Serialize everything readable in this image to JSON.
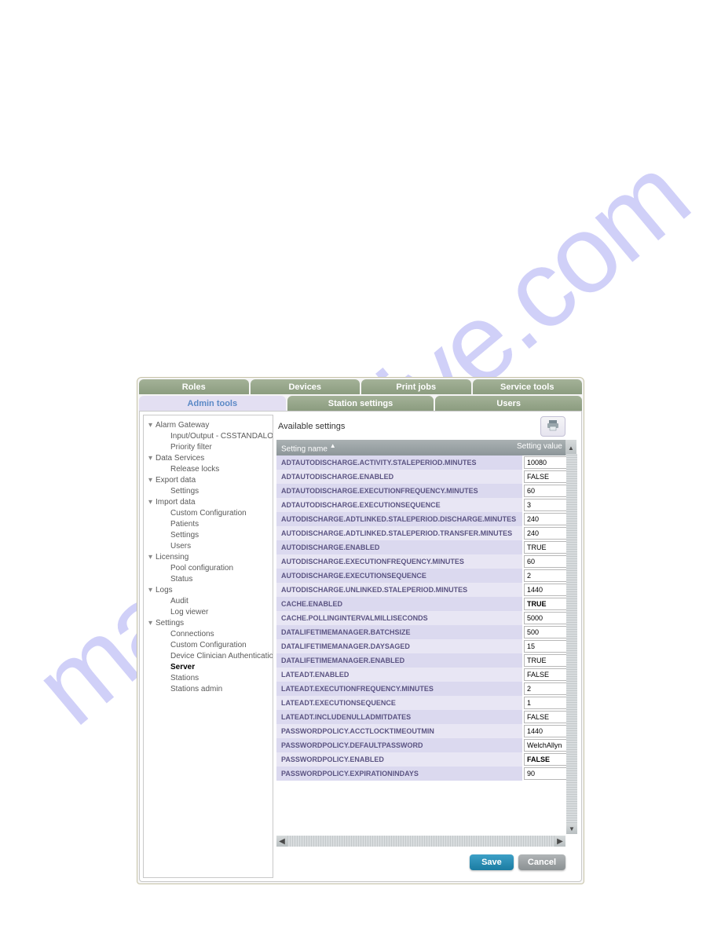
{
  "watermark": "manualshive.com",
  "tabsTop": [
    {
      "label": "Roles"
    },
    {
      "label": "Devices"
    },
    {
      "label": "Print jobs"
    },
    {
      "label": "Service tools"
    }
  ],
  "tabsBottom": [
    {
      "label": "Admin tools",
      "active": true
    },
    {
      "label": "Station settings"
    },
    {
      "label": "Users"
    }
  ],
  "tree": [
    {
      "label": "Alarm Gateway",
      "children": [
        {
          "label": "Input/Output - CSSTANDALONE-PC"
        },
        {
          "label": "Priority filter"
        }
      ]
    },
    {
      "label": "Data Services",
      "children": [
        {
          "label": "Release locks"
        }
      ]
    },
    {
      "label": "Export data",
      "children": [
        {
          "label": "Settings"
        }
      ]
    },
    {
      "label": "Import data",
      "children": [
        {
          "label": "Custom Configuration"
        },
        {
          "label": "Patients"
        },
        {
          "label": "Settings"
        },
        {
          "label": "Users"
        }
      ]
    },
    {
      "label": "Licensing",
      "children": [
        {
          "label": "Pool configuration"
        },
        {
          "label": "Status"
        }
      ]
    },
    {
      "label": "Logs",
      "children": [
        {
          "label": "Audit"
        },
        {
          "label": "Log viewer"
        }
      ]
    },
    {
      "label": "Settings",
      "children": [
        {
          "label": "Connections"
        },
        {
          "label": "Custom Configuration"
        },
        {
          "label": "Device Clinician Authentication"
        },
        {
          "label": "Server",
          "selected": true
        },
        {
          "label": "Stations"
        },
        {
          "label": "Stations admin"
        }
      ]
    }
  ],
  "mainTitle": "Available settings",
  "columns": {
    "name": "Setting name",
    "sortIndicator": "▲",
    "value": "Setting value"
  },
  "settings": [
    {
      "name": "ADTAUTODISCHARGE.ACTIVITY.STALEPERIOD.MINUTES",
      "value": "10080"
    },
    {
      "name": "ADTAUTODISCHARGE.ENABLED",
      "value": "FALSE"
    },
    {
      "name": "ADTAUTODISCHARGE.EXECUTIONFREQUENCY.MINUTES",
      "value": "60"
    },
    {
      "name": "ADTAUTODISCHARGE.EXECUTIONSEQUENCE",
      "value": "3"
    },
    {
      "name": "AUTODISCHARGE.ADTLINKED.STALEPERIOD.DISCHARGE.MINUTES",
      "value": "240"
    },
    {
      "name": "AUTODISCHARGE.ADTLINKED.STALEPERIOD.TRANSFER.MINUTES",
      "value": "240"
    },
    {
      "name": "AUTODISCHARGE.ENABLED",
      "value": "TRUE"
    },
    {
      "name": "AUTODISCHARGE.EXECUTIONFREQUENCY.MINUTES",
      "value": "60"
    },
    {
      "name": "AUTODISCHARGE.EXECUTIONSEQUENCE",
      "value": "2"
    },
    {
      "name": "AUTODISCHARGE.UNLINKED.STALEPERIOD.MINUTES",
      "value": "1440"
    },
    {
      "name": "CACHE.ENABLED",
      "value": "TRUE",
      "bold": true
    },
    {
      "name": "CACHE.POLLINGINTERVALMILLISECONDS",
      "value": "5000"
    },
    {
      "name": "DATALIFETIMEMANAGER.BATCHSIZE",
      "value": "500"
    },
    {
      "name": "DATALIFETIMEMANAGER.DAYSAGED",
      "value": "15"
    },
    {
      "name": "DATALIFETIMEMANAGER.ENABLED",
      "value": "TRUE"
    },
    {
      "name": "LATEADT.ENABLED",
      "value": "FALSE"
    },
    {
      "name": "LATEADT.EXECUTIONFREQUENCY.MINUTES",
      "value": "2"
    },
    {
      "name": "LATEADT.EXECUTIONSEQUENCE",
      "value": "1"
    },
    {
      "name": "LATEADT.INCLUDENULLADMITDATES",
      "value": "FALSE"
    },
    {
      "name": "PASSWORDPOLICY.ACCTLOCKTIMEOUTMIN",
      "value": "1440"
    },
    {
      "name": "PASSWORDPOLICY.DEFAULTPASSWORD",
      "value": "WelchAllyn"
    },
    {
      "name": "PASSWORDPOLICY.ENABLED",
      "value": "FALSE",
      "bold": true
    },
    {
      "name": "PASSWORDPOLICY.EXPIRATIONINDAYS",
      "value": "90"
    }
  ],
  "buttons": {
    "save": "Save",
    "cancel": "Cancel"
  }
}
